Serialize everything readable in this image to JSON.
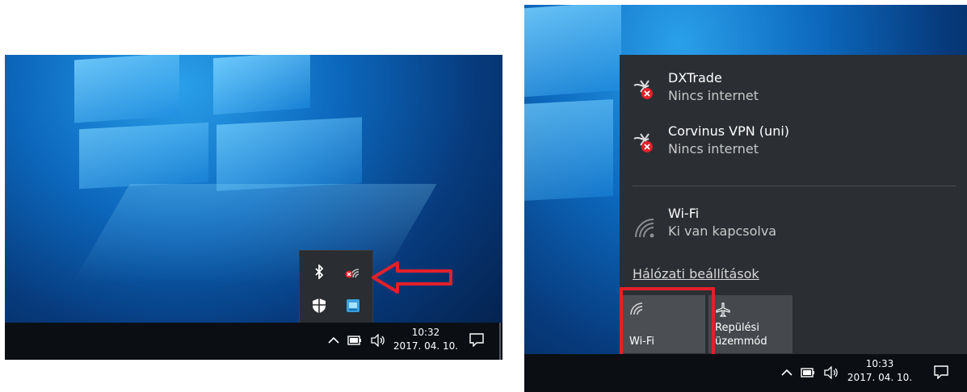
{
  "left": {
    "clock": {
      "time": "10:32",
      "date": "2017. 04. 10."
    },
    "tray_popup_icons": [
      "bluetooth-icon",
      "network-disconnected-icon",
      "security-shield-icon",
      "app-icon"
    ]
  },
  "right": {
    "networks": [
      {
        "name": "DXTrade",
        "status": "Nincs internet",
        "icon": "vpn-no-internet-icon"
      },
      {
        "name": "Corvinus VPN (uni)",
        "status": "Nincs internet",
        "icon": "vpn-no-internet-icon"
      },
      {
        "name": "Wi-Fi",
        "status": "Ki van kapcsolva",
        "icon": "wifi-off-icon"
      }
    ],
    "settings_link": "Hálózati beállítások",
    "quick_actions": [
      {
        "label": "Wi-Fi",
        "icon": "wifi-icon",
        "state": "off"
      },
      {
        "label_line1": "Repülési",
        "label_line2": "üzemmód",
        "icon": "airplane-icon",
        "state": "off"
      }
    ],
    "clock": {
      "time": "10:33",
      "date": "2017. 04. 10."
    }
  },
  "colors": {
    "highlight": "#e3202a",
    "flyout_bg": "#2b2e33",
    "taskbar_bg": "#0b0f14"
  }
}
